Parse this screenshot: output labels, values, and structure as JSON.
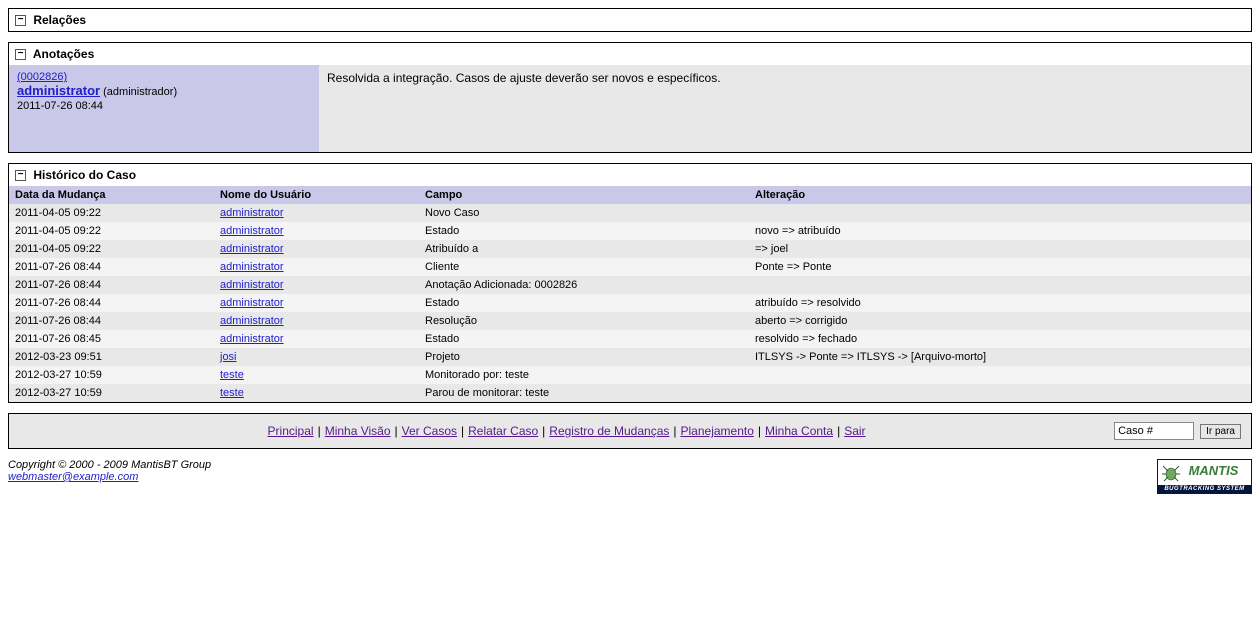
{
  "relations": {
    "title": "Relações"
  },
  "notes": {
    "title": "Anotações",
    "items": [
      {
        "id": "(0002826)",
        "user": "administrator",
        "role": "(administrador)",
        "date": "2011-07-26 08:44",
        "text": "Resolvida a integração. Casos de ajuste deverão ser novos e específicos."
      }
    ]
  },
  "history": {
    "title": "Histórico do Caso",
    "headers": {
      "date": "Data da Mudança",
      "user": "Nome do Usuário",
      "field": "Campo",
      "change": "Alteração"
    },
    "rows": [
      {
        "date": "2011-04-05 09:22",
        "user": "administrator",
        "field": "Novo Caso",
        "change": ""
      },
      {
        "date": "2011-04-05 09:22",
        "user": "administrator",
        "field": "Estado",
        "change": "novo => atribuído"
      },
      {
        "date": "2011-04-05 09:22",
        "user": "administrator",
        "field": "Atribuído a",
        "change": "=> joel"
      },
      {
        "date": "2011-07-26 08:44",
        "user": "administrator",
        "field": "Cliente",
        "change": "Ponte => Ponte"
      },
      {
        "date": "2011-07-26 08:44",
        "user": "administrator",
        "field": "Anotação Adicionada: 0002826",
        "change": ""
      },
      {
        "date": "2011-07-26 08:44",
        "user": "administrator",
        "field": "Estado",
        "change": "atribuído => resolvido"
      },
      {
        "date": "2011-07-26 08:44",
        "user": "administrator",
        "field": "Resolução",
        "change": "aberto => corrigido"
      },
      {
        "date": "2011-07-26 08:45",
        "user": "administrator",
        "field": "Estado",
        "change": "resolvido => fechado"
      },
      {
        "date": "2012-03-23 09:51",
        "user": "josi",
        "field": "Projeto",
        "change": "ITLSYS -> Ponte => ITLSYS -> [Arquivo-morto]"
      },
      {
        "date": "2012-03-27 10:59",
        "user": "teste",
        "field": "Monitorado por: teste",
        "change": ""
      },
      {
        "date": "2012-03-27 10:59",
        "user": "teste",
        "field": "Parou de monitorar: teste",
        "change": ""
      }
    ]
  },
  "footer": {
    "links": [
      "Principal",
      "Minha Visão",
      "Ver Casos",
      "Relatar Caso",
      "Registro de Mudanças",
      "Planejamento",
      "Minha Conta",
      "Sair"
    ],
    "search_placeholder": "Caso #",
    "go_label": "Ir para"
  },
  "copyright": {
    "text": "Copyright © 2000 - 2009 MantisBT Group",
    "email": "webmaster@example.com",
    "logo_name": "MANTIS",
    "logo_sub": "BUGTRACKING SYSTEM"
  }
}
